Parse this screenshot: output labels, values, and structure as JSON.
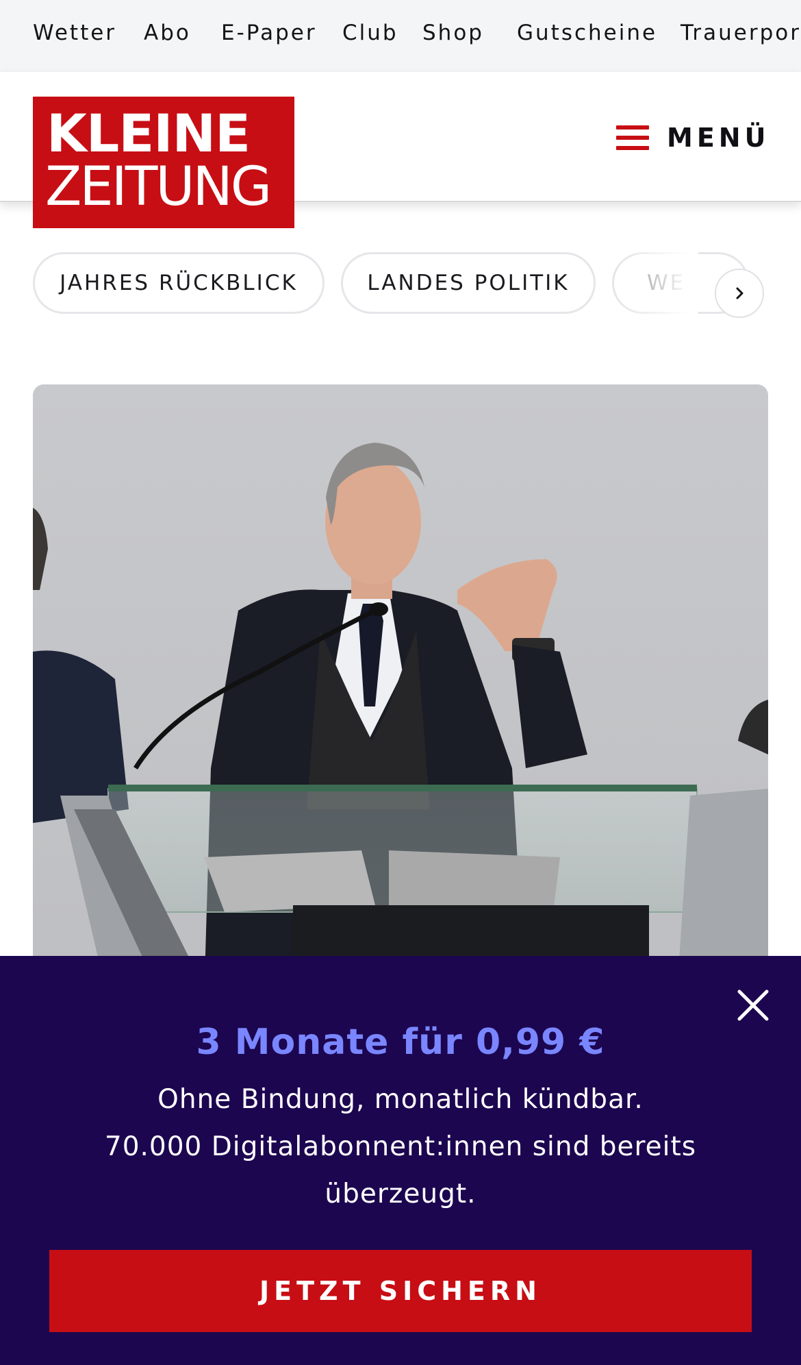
{
  "topnav": {
    "items": [
      "Wetter",
      "Abo",
      "E-Paper",
      "Club",
      "Shop",
      "Gutscheine",
      "Trauerportal"
    ]
  },
  "header": {
    "logo_line1": "KLEINE",
    "logo_line2": "ZEITUNG",
    "menu_label": "MENÜ"
  },
  "chips": [
    "JAHRES RÜCKBLICK",
    "LANDES POLITIK",
    "WE"
  ],
  "promo": {
    "headline": "3 Monate für 0,99 €",
    "line1": "Ohne Bindung, monatlich kündbar.",
    "line2": "70.000 Digitalabonnent:innen sind bereits überzeugt.",
    "cta": "JETZT SICHERN"
  },
  "colors": {
    "brand_red": "#c70e14",
    "promo_bg": "#1c0650",
    "promo_headline": "#7a86ff",
    "topnav_bg": "#f4f5f7"
  },
  "icons": {
    "menu": "hamburger-icon",
    "chips_next": "chevron-right-icon",
    "promo_close": "close-icon"
  }
}
